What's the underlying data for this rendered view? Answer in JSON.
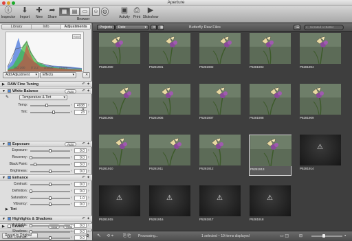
{
  "window": {
    "title": "Aperture"
  },
  "toolbar": {
    "left": [
      {
        "label": "Inspector"
      },
      {
        "label": "Import"
      },
      {
        "label": "New"
      },
      {
        "label": "Share"
      }
    ],
    "browser_label": "Browser",
    "right": [
      {
        "label": "Activity"
      },
      {
        "label": "Print"
      },
      {
        "label": "Slideshow"
      }
    ]
  },
  "sidebar": {
    "tabs": [
      "Library",
      "Info",
      "Adjustments"
    ],
    "histogram": {
      "raw_badge": "RAW",
      "meta": [
        "ISO 200",
        "ƒ/ 2.2",
        "1/4000",
        "75mm"
      ]
    },
    "add_adjustment": "Add Adjustment",
    "effects": "Effects",
    "sections": {
      "raw_fine_tuning": "RAW Fine Tuning",
      "white_balance": "White Balance",
      "wb_mode": "Temperature & Tint",
      "exposure": "Exposure",
      "enhance": "Enhance",
      "tint": "Tint",
      "highlights_shadows": "Highlights & Shadows",
      "levels": "Levels"
    },
    "auto": "Auto",
    "sliders": {
      "temp": {
        "label": "Temp:",
        "value": "4938 K",
        "pos": 0.42
      },
      "tint": {
        "label": "Tint:",
        "value": "23",
        "pos": 0.58
      },
      "exposure": {
        "label": "Exposure:",
        "value": "0.0",
        "pos": 0.5
      },
      "recovery": {
        "label": "Recovery:",
        "value": "0.0",
        "pos": 0.02
      },
      "black_point": {
        "label": "Black Point:",
        "value": "3.0",
        "pos": 0.12
      },
      "brightness": {
        "label": "Brightness:",
        "value": "0.0",
        "pos": 0.5
      },
      "contrast": {
        "label": "Contrast:",
        "value": "0.0",
        "pos": 0.5
      },
      "definition": {
        "label": "Definition:",
        "value": "0.0",
        "pos": 0.02
      },
      "saturation": {
        "label": "Saturation:",
        "value": "1.0",
        "pos": 0.5
      },
      "vibrancy": {
        "label": "Vibrancy:",
        "value": "0.0",
        "pos": 0.5
      },
      "highlights": {
        "label": "Highlights:",
        "value": "0.0",
        "pos": 0.02
      },
      "shadows": {
        "label": "Shadows:",
        "value": "0.0",
        "pos": 0.02
      },
      "mid_contrast": {
        "label": "Mid Contrast:",
        "value": "0.0",
        "pos": 0.5
      }
    },
    "revert": "Revert to Original"
  },
  "browser": {
    "projects": "Projects",
    "sort": "Date",
    "title": "Butterfly Raw Files",
    "search_placeholder": "Unrated or Better",
    "status": "1 selected – 19 items displayed",
    "processing": "Processing...",
    "thumbs": [
      {
        "name": "P5281900",
        "kind": "photo"
      },
      {
        "name": "P5281901",
        "kind": "photo"
      },
      {
        "name": "P5281902",
        "kind": "photo"
      },
      {
        "name": "P5281903",
        "kind": "photo"
      },
      {
        "name": "P5281904",
        "kind": "photo"
      },
      {
        "name": "P5281905",
        "kind": "photo"
      },
      {
        "name": "P5281906",
        "kind": "photo"
      },
      {
        "name": "P5281907",
        "kind": "photo"
      },
      {
        "name": "P5281908",
        "kind": "photo"
      },
      {
        "name": "P5281909",
        "kind": "photo"
      },
      {
        "name": "P5281910",
        "kind": "photo"
      },
      {
        "name": "P5281911",
        "kind": "photo"
      },
      {
        "name": "P5281912",
        "kind": "photo"
      },
      {
        "name": "P5281913",
        "kind": "photo",
        "selected": true
      },
      {
        "name": "P5281914",
        "kind": "warning"
      },
      {
        "name": "P5281915",
        "kind": "warning"
      },
      {
        "name": "P5281916",
        "kind": "warning"
      },
      {
        "name": "P5281917",
        "kind": "warning"
      },
      {
        "name": "P5281918",
        "kind": "warning"
      }
    ]
  }
}
